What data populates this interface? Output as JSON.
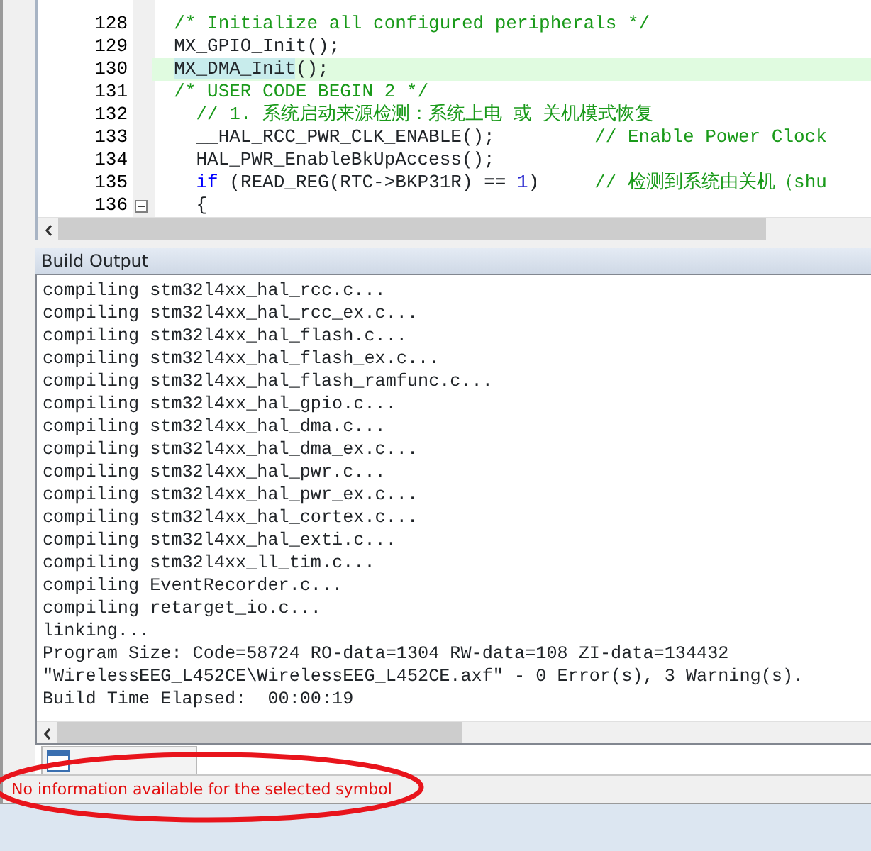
{
  "editor": {
    "lines": [
      {
        "number": "128",
        "current": false,
        "fold": false,
        "segments": [
          {
            "kind": "comment",
            "text": "  /* Initialize all configured peripherals */"
          }
        ]
      },
      {
        "number": "129",
        "current": false,
        "fold": false,
        "segments": [
          {
            "kind": "plain",
            "text": "  MX_GPIO_Init();"
          }
        ]
      },
      {
        "number": "130",
        "current": true,
        "fold": false,
        "segments": [
          {
            "kind": "match",
            "text": "  MX_DMA_Init"
          },
          {
            "kind": "plain",
            "text": "();"
          }
        ]
      },
      {
        "number": "131",
        "current": false,
        "fold": false,
        "segments": [
          {
            "kind": "comment",
            "text": "  /* USER CODE BEGIN 2 */"
          }
        ]
      },
      {
        "number": "132",
        "current": false,
        "fold": false,
        "segments": [
          {
            "kind": "comment",
            "text": "    // 1. 系统启动来源检测：系统上电 或 关机模式恢复"
          }
        ]
      },
      {
        "number": "133",
        "current": false,
        "fold": false,
        "segments": [
          {
            "kind": "plain",
            "text": "    __HAL_RCC_PWR_CLK_ENABLE();         "
          },
          {
            "kind": "comment",
            "text": "// Enable Power Clock"
          }
        ]
      },
      {
        "number": "134",
        "current": false,
        "fold": false,
        "segments": [
          {
            "kind": "plain",
            "text": "    HAL_PWR_EnableBkUpAccess();"
          }
        ]
      },
      {
        "number": "135",
        "current": false,
        "fold": false,
        "segments": [
          {
            "kind": "keyword",
            "text": "    if"
          },
          {
            "kind": "plain",
            "text": " (READ_REG(RTC->BKP31R) == "
          },
          {
            "kind": "number",
            "text": "1"
          },
          {
            "kind": "plain",
            "text": ")     "
          },
          {
            "kind": "comment",
            "text": "// 检测到系统由关机（shu"
          }
        ]
      },
      {
        "number": "136",
        "current": false,
        "fold": true,
        "segments": [
          {
            "kind": "plain",
            "text": "    {"
          }
        ]
      }
    ]
  },
  "output_panel": {
    "title": "Build Output",
    "lines": [
      "compiling stm32l4xx_hal_rcc.c...",
      "compiling stm32l4xx_hal_rcc_ex.c...",
      "compiling stm32l4xx_hal_flash.c...",
      "compiling stm32l4xx_hal_flash_ex.c...",
      "compiling stm32l4xx_hal_flash_ramfunc.c...",
      "compiling stm32l4xx_hal_gpio.c...",
      "compiling stm32l4xx_hal_dma.c...",
      "compiling stm32l4xx_hal_dma_ex.c...",
      "compiling stm32l4xx_hal_pwr.c...",
      "compiling stm32l4xx_hal_pwr_ex.c...",
      "compiling stm32l4xx_hal_cortex.c...",
      "compiling stm32l4xx_hal_exti.c...",
      "compiling stm32l4xx_ll_tim.c...",
      "compiling EventRecorder.c...",
      "compiling retarget_io.c...",
      "linking...",
      "Program Size: Code=58724 RO-data=1304 RW-data=108 ZI-data=134432",
      "\"WirelessEEG_L452CE\\WirelessEEG_L452CE.axf\" - 0 Error(s), 3 Warning(s).",
      "Build Time Elapsed:  00:00:19"
    ]
  },
  "tabs": [
    {
      "selected": false
    }
  ],
  "status_bar": {
    "text": "No information available for the selected symbol"
  }
}
